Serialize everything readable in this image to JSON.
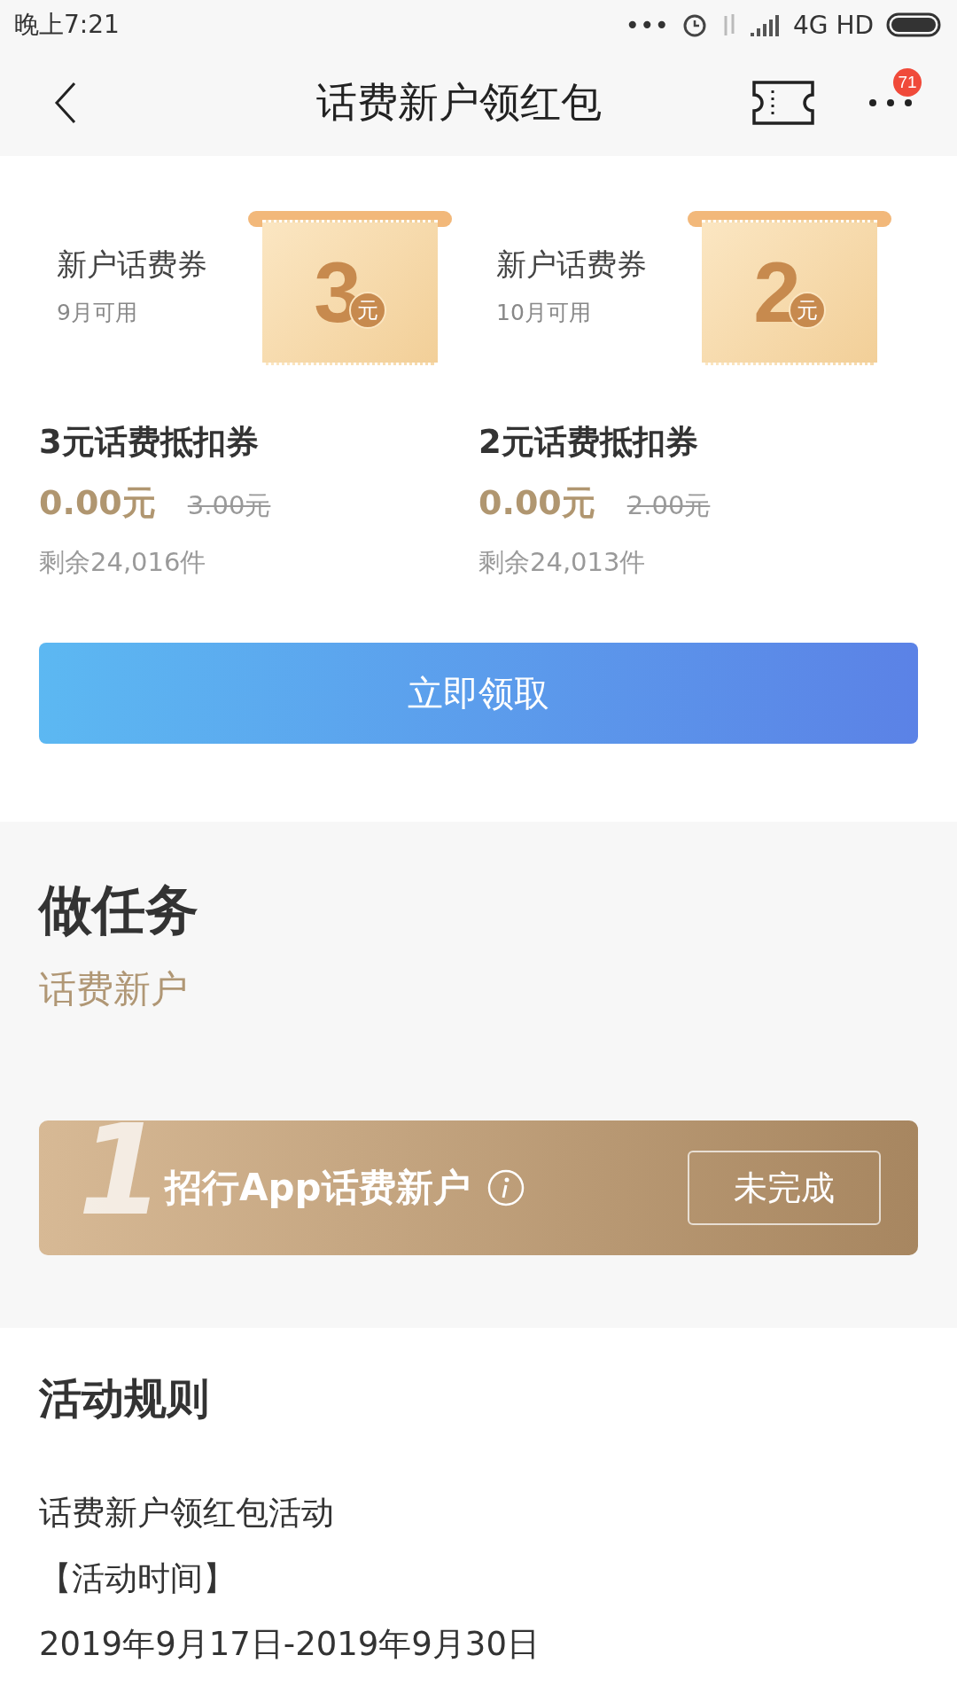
{
  "status_bar": {
    "time": "晚上7:21",
    "dots": "•••",
    "network": "4G HD"
  },
  "nav": {
    "title": "话费新户领红包",
    "badge": "71"
  },
  "coupons": [
    {
      "label": "新户话费券",
      "month": "9月可用",
      "amount": "3",
      "unit": "元",
      "name": "3元话费抵扣券",
      "price": "0.00元",
      "original_price": "3.00元",
      "remaining": "剩余24,016件"
    },
    {
      "label": "新户话费券",
      "month": "10月可用",
      "amount": "2",
      "unit": "元",
      "name": "2元话费抵扣券",
      "price": "0.00元",
      "original_price": "2.00元",
      "remaining": "剩余24,013件"
    }
  ],
  "claim_button": "立即领取",
  "tasks_section": {
    "title": "做任务",
    "subtitle": "话费新户",
    "tasks": [
      {
        "index": "1",
        "title": "招行App话费新户",
        "status": "未完成",
        "completed": false
      }
    ]
  },
  "rules": {
    "title": "活动规则",
    "lines": [
      "话费新户领红包活动",
      "【活动时间】",
      "2019年9月17日-2019年9月30日"
    ]
  }
}
